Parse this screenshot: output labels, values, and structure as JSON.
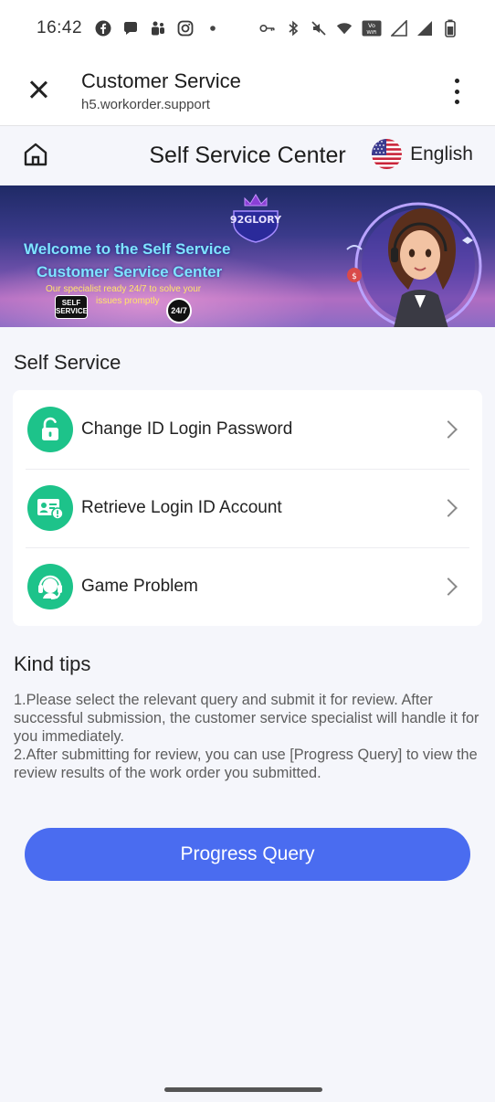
{
  "status_bar": {
    "time": "16:42",
    "left_icons": [
      "facebook-icon",
      "chat-bubble-icon",
      "teams-icon",
      "instagram-icon",
      "dot-icon"
    ],
    "right_icons": [
      "key-icon",
      "bluetooth-icon",
      "mute-icon",
      "wifi-icon",
      "vowifi-icon",
      "signal-icon",
      "signal-icon",
      "battery-icon"
    ],
    "vowifi_text": "Vo WiFi"
  },
  "browser": {
    "title": "Customer Service",
    "url": "h5.workorder.support"
  },
  "header": {
    "title": "Self Service Center",
    "language": "English"
  },
  "banner": {
    "logo_text": "92GLORY",
    "welcome_line1": "Welcome to the Self Service",
    "welcome_line2": "Customer Service Center",
    "subtext_line1": "Our specialist ready 24/7 to solve your",
    "subtext_line2": "issues promptly",
    "badge_self": "SELF SERVICE",
    "badge_clock": "24/7"
  },
  "self_service": {
    "title": "Self Service",
    "items": [
      {
        "label": "Change ID Login Password",
        "icon": "lock-icon"
      },
      {
        "label": "Retrieve Login ID Account",
        "icon": "id-card-icon"
      },
      {
        "label": "Game Problem",
        "icon": "headset-icon"
      }
    ]
  },
  "kind_tips": {
    "title": "Kind tips",
    "tip1": "1.Please select the relevant query and submit it for review. After successful submission, the customer service specialist will handle it for you immediately.",
    "tip2": "2.After submitting for review, you can use [Progress Query] to view the review results of the work order you submitted."
  },
  "progress_button": {
    "label": "Progress Query"
  },
  "colors": {
    "accent_green": "#1dc38a",
    "button_blue": "#4a6cf0",
    "background": "#f5f6fb"
  }
}
